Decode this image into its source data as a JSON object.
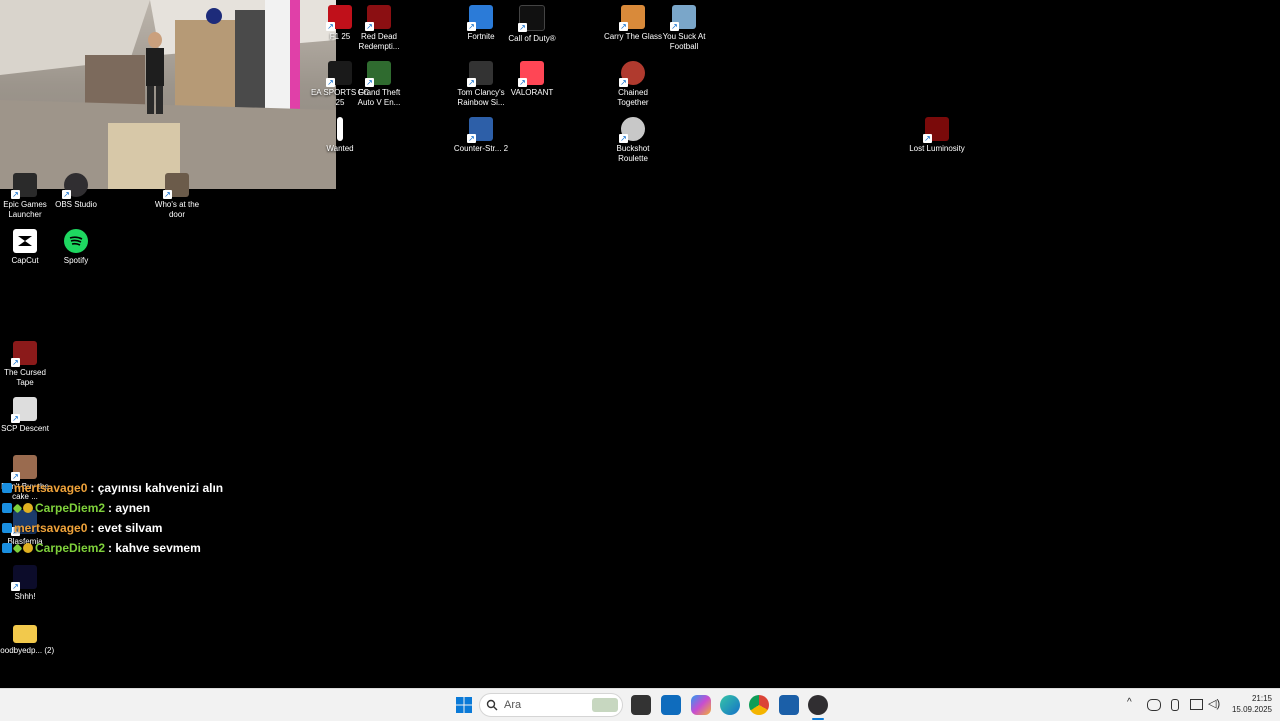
{
  "desktop_icons": [
    {
      "label": "F1 25",
      "color": "#c0101a"
    },
    {
      "label": "Red Dead Redempti...",
      "color": "#8b0f12"
    },
    {
      "label": "Fortnite",
      "color": "#2b7bd8"
    },
    {
      "label": "Call of Duty®",
      "color": "#111111"
    },
    {
      "label": "Carry The Glass",
      "color": "#d98a3a"
    },
    {
      "label": "You Suck At Football",
      "color": "#7aa6c9"
    },
    {
      "label": "EA SPORTS FC 25",
      "color": "#1a1a1a"
    },
    {
      "label": "Grand Theft Auto V En...",
      "color": "#2f6b2f"
    },
    {
      "label": "Tom Clancy's Rainbow Si...",
      "color": "#333333"
    },
    {
      "label": "VALORANT",
      "color": "#ff4655"
    },
    {
      "label": "Chained Together",
      "color": "#b03a2e"
    },
    {
      "label": "Wanted",
      "color": "#ffffff"
    },
    {
      "label": "Counter-Str... 2",
      "color": "#2d5fa8"
    },
    {
      "label": "Buckshot Roulette",
      "color": "#c8c8c8"
    },
    {
      "label": "Lost Luminosity",
      "color": "#7a0a0a"
    },
    {
      "label": "Epic Games Launcher",
      "color": "#2a2a2a"
    },
    {
      "label": "OBS Studio",
      "color": "#302e31"
    },
    {
      "label": "Who's at the door",
      "color": "#6b5b4a"
    },
    {
      "label": "CapCut",
      "color": "#ffffff"
    },
    {
      "label": "Spotify",
      "color": "#1ed760"
    },
    {
      "label": "The Cursed Tape",
      "color": "#8b1a1a"
    },
    {
      "label": "SCP Descent",
      "color": "#dddddd"
    },
    {
      "label": "Don't Buy the cake ...",
      "color": "#9a6b4f"
    },
    {
      "label": "Blasfemia",
      "color": "#1b3b6b"
    },
    {
      "label": "Shhh!",
      "color": "#0c0c2a"
    },
    {
      "label": "goodbyedp... (2)",
      "color": "#f2c94c"
    }
  ],
  "webcam": {
    "label": "webcam-overlay"
  },
  "chat": [
    {
      "user": "mertsavage0",
      "user_color": "#f0a33a",
      "message": ": çayınısı kahvenizi alın"
    },
    {
      "user": "CarpeDiem2",
      "user_color": "#7fd13b",
      "message": ": aynen"
    },
    {
      "user": "mertsavage0",
      "user_color": "#f0a33a",
      "message": ": evet silvam"
    },
    {
      "user": "CarpeDiem2",
      "user_color": "#7fd13b",
      "message": ": kahve sevmem"
    }
  ],
  "taskbar": {
    "search_placeholder": "Ara",
    "time": "21:15",
    "date": "15.09.2025"
  }
}
